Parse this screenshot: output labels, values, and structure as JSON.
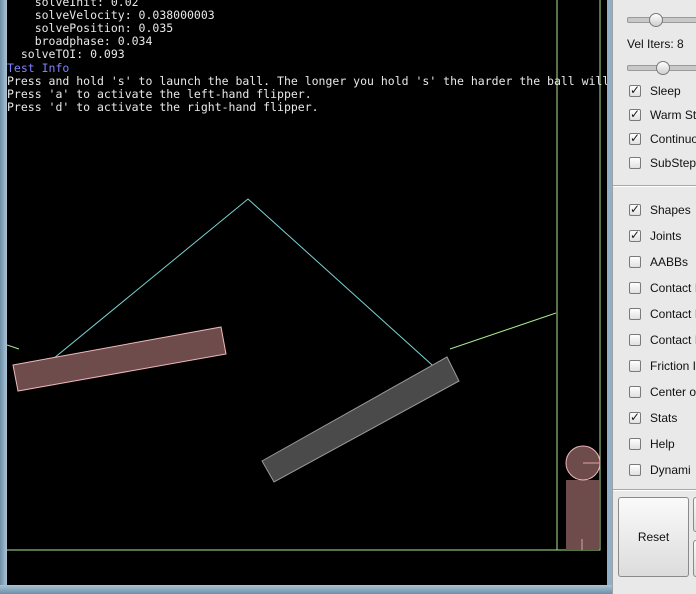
{
  "stats": {
    "lines": [
      "    solveInit: 0.02",
      "    solveVelocity: 0.038000003",
      "    solvePosition: 0.035",
      "    broadphase: 0.034",
      "  solveTOI: 0.093"
    ]
  },
  "test_info": {
    "title": "Test Info",
    "lines": [
      "Press and hold 's' to launch the ball. The longer you hold 's' the harder the ball will",
      "Press 'a' to activate the left-hand flipper.",
      "Press 'd' to activate the right-hand flipper."
    ]
  },
  "scene_colors": {
    "background": "#000000",
    "static_edges": "#a8e890",
    "joint_lines": "#7ad0d0",
    "flipper_left_fill": "#6e4c4c",
    "flipper_left_stroke": "#f0b8b8",
    "flipper_right_fill": "#4a4a4a",
    "flipper_right_stroke": "#9c9c9c",
    "plunger_fill": "#6e4c4c",
    "ball_fill": "#6e4c4c"
  },
  "panel": {
    "vel_iters_label": "Vel Iters: 8",
    "position_slider_level": 0.3,
    "velocity_slider_level": 0.38,
    "settings": [
      {
        "label": "Sleep",
        "checked": true
      },
      {
        "label": "Warm St",
        "checked": true
      },
      {
        "label": "Continuo",
        "checked": true
      },
      {
        "label": "SubStep",
        "checked": false
      }
    ],
    "draw": [
      {
        "label": "Shapes",
        "checked": true
      },
      {
        "label": "Joints",
        "checked": true
      },
      {
        "label": "AABBs",
        "checked": false
      },
      {
        "label": "Contact I",
        "checked": false
      },
      {
        "label": "Contact I",
        "checked": false
      },
      {
        "label": "Contact I",
        "checked": false
      },
      {
        "label": "Friction I",
        "checked": false
      },
      {
        "label": "Center o",
        "checked": false
      },
      {
        "label": "Stats",
        "checked": true
      },
      {
        "label": "Help",
        "checked": false
      },
      {
        "label": "Dynami",
        "checked": false
      }
    ],
    "reset_label": "Reset"
  }
}
